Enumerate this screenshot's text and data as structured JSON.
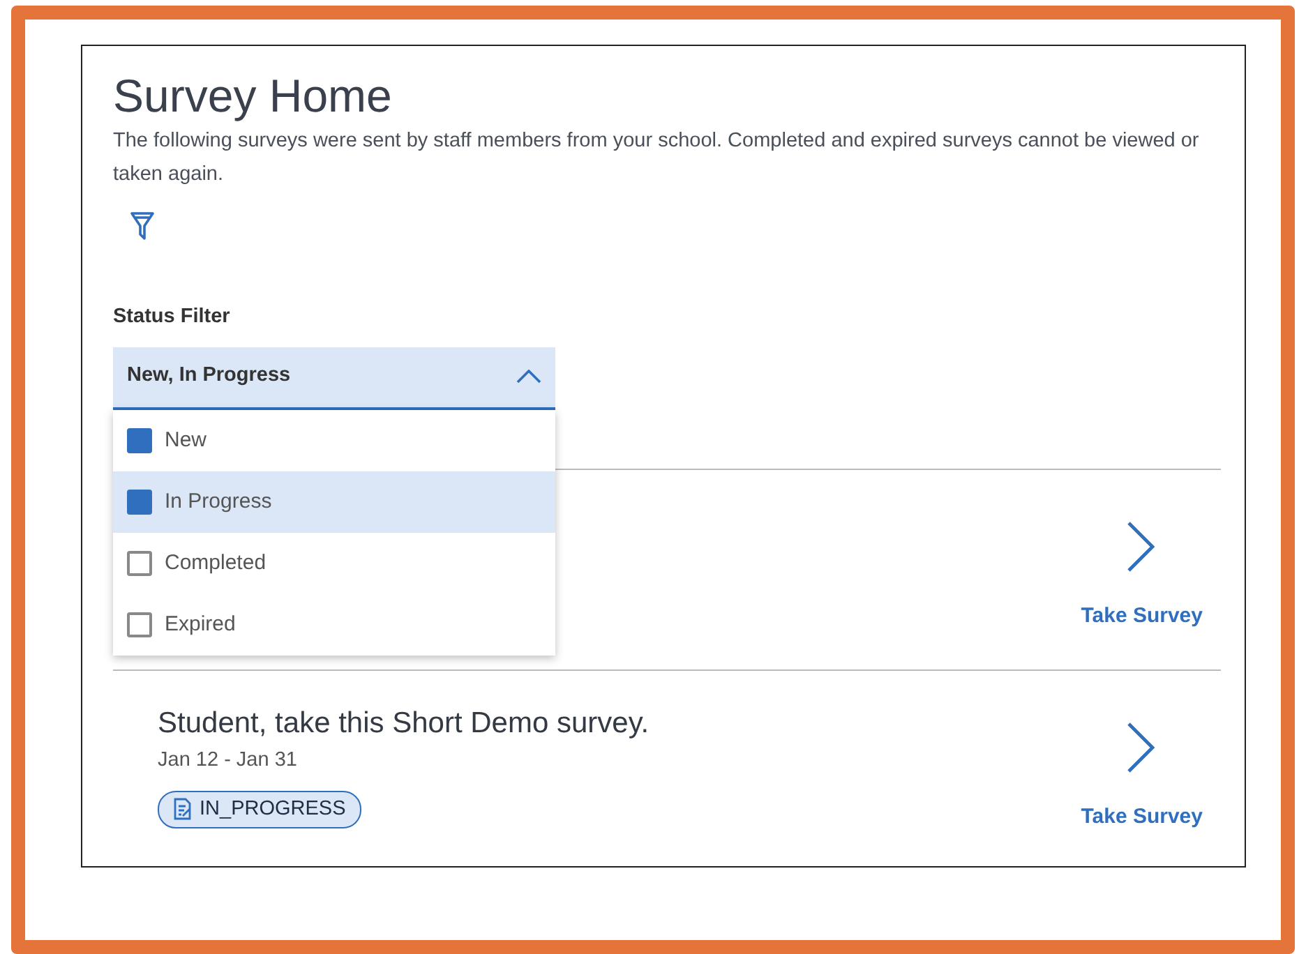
{
  "title": "Survey Home",
  "description": "The following surveys were sent by staff members from your school. Completed and expired surveys cannot be viewed or taken again.",
  "status_filter": {
    "label": "Status Filter",
    "value": "New, In Progress",
    "expanded": true,
    "options": [
      {
        "label": "New",
        "checked": true,
        "selected": false
      },
      {
        "label": "In Progress",
        "checked": true,
        "selected": true
      },
      {
        "label": "Completed",
        "checked": false,
        "selected": false
      },
      {
        "label": "Expired",
        "checked": false,
        "selected": false
      }
    ]
  },
  "surveys": [
    {
      "action": "Take Survey"
    },
    {
      "title": "Student, take this Short Demo survey.",
      "dates": "Jan 12 - Jan 31",
      "status": "IN_PROGRESS",
      "action": "Take Survey"
    }
  ]
}
